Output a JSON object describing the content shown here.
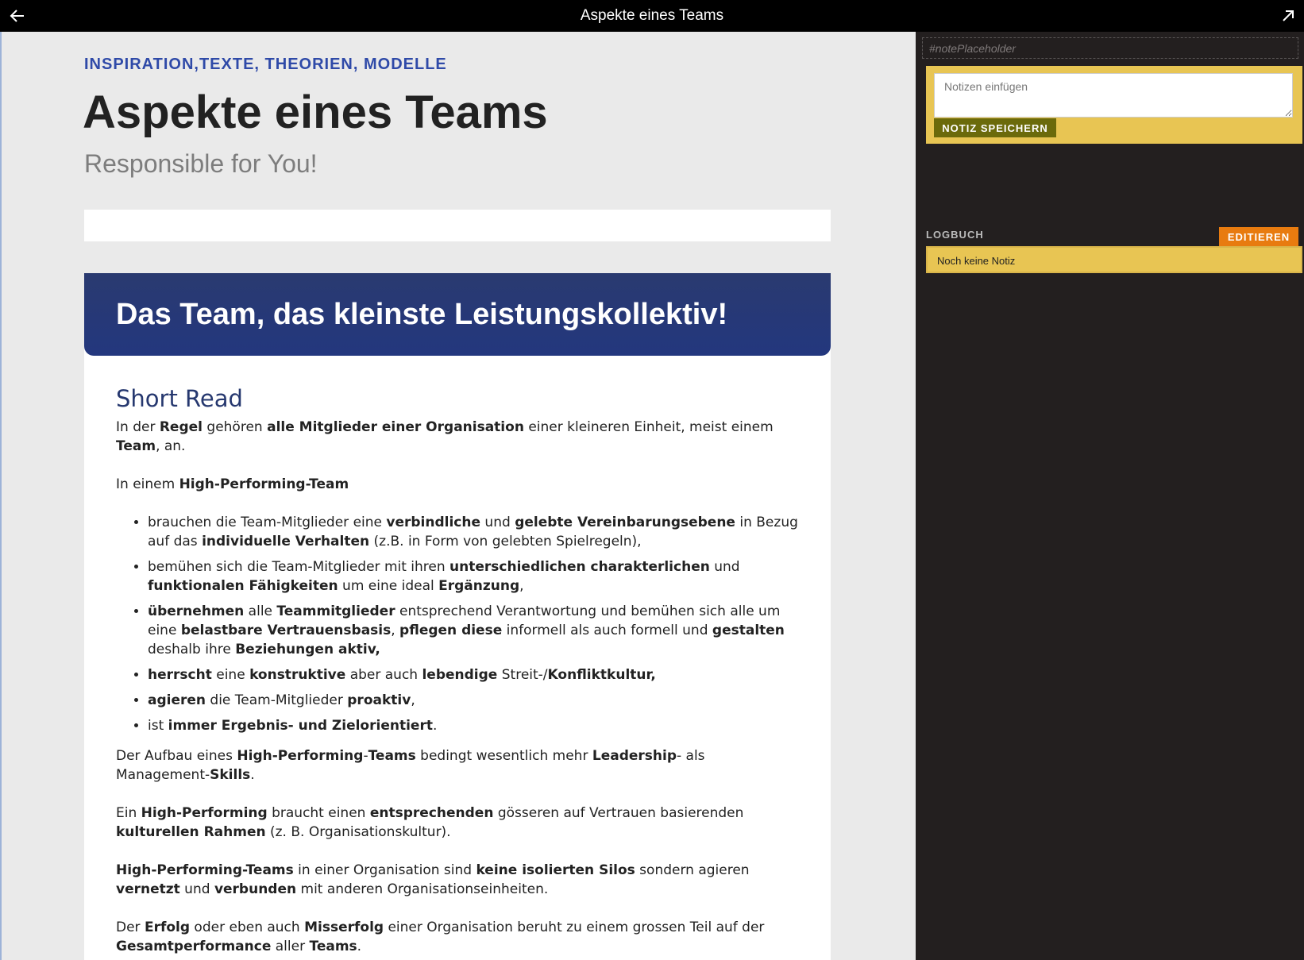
{
  "topbar": {
    "title": "Aspekte eines Teams",
    "back_icon": "arrow-left-icon",
    "expand_icon": "arrow-up-right-icon"
  },
  "main": {
    "kicker": "INSPIRATION,TEXTE, THEORIEN, MODELLE",
    "title": "Aspekte eines Teams",
    "subtitle": "Responsible for You!",
    "card": {
      "header": "Das Team, das kleinste Leistungskollektiv!",
      "section_title": "Short Read",
      "p1": [
        "In der ",
        "Regel",
        " gehören ",
        "alle Mitglieder einer Organisation",
        " einer kleineren Einheit, meist einem ",
        "Team",
        ", an."
      ],
      "p2": [
        "In einem ",
        "High-Performing-Team"
      ],
      "bullets": [
        [
          "brauchen die Team-Mitglieder eine ",
          "verbindliche",
          " und ",
          "gelebte Vereinbarungsebene",
          " in Bezug auf das ",
          "individuelle Verhalten",
          " (z.B. in Form von gelebten Spielregeln),"
        ],
        [
          "bemühen sich die Team-Mitglieder mit ihren ",
          "unterschiedlichen charakterlichen",
          " und ",
          "funktionalen Fähigkeiten",
          " um eine ideal ",
          "Ergänzung",
          ","
        ],
        [
          "",
          "übernehmen",
          " alle ",
          "Teammitglieder",
          " entsprechend Verantwortung und bemühen sich alle um eine ",
          "belastbare Vertrauensbasis",
          ", ",
          "pflegen diese",
          " informell als auch formell und ",
          "gestalten",
          " deshalb ihre ",
          "Beziehungen aktiv,"
        ],
        [
          "",
          "herrscht",
          " eine ",
          "konstruktive",
          " aber auch ",
          "lebendige",
          " Streit-/",
          "Konfliktkultur,"
        ],
        [
          "",
          "agieren",
          " die Team-Mitglieder ",
          "proaktiv",
          ","
        ],
        [
          "ist ",
          "immer Ergebnis- und Zielorientiert",
          "."
        ]
      ],
      "p3": [
        "Der Aufbau eines ",
        "High-Performing",
        "-",
        "Teams",
        " bedingt wesentlich mehr ",
        "Leadership",
        "- als Management-",
        "Skills",
        "."
      ],
      "p4": [
        "Ein ",
        "High-Performing",
        " braucht einen ",
        "entsprechenden",
        " gösseren auf Vertrauen basierenden ",
        "kulturellen Rahmen",
        " (z. B. Organisationskultur)."
      ],
      "p5": [
        "",
        "High-Performing-Teams",
        " in einer Organisation sind ",
        "keine isolierten Silos",
        " sondern agieren ",
        "vernetzt",
        " und ",
        "verbunden",
        " mit anderen Organisationseinheiten."
      ],
      "p6": [
        "Der ",
        "Erfolg",
        " oder eben auch ",
        "Misserfolg",
        " einer Organisation beruht zu einem grossen Teil auf der ",
        "Gesamtperformance",
        " aller ",
        "Teams",
        "."
      ]
    }
  },
  "sidebar": {
    "placeholder_label": "#notePlaceholder",
    "notes_placeholder": "Notizen einfügen",
    "save_label": "NOTIZ SPEICHERN",
    "log_label": "LOGBUCH",
    "edit_label": "EDITIEREN",
    "log_entry": "Noch keine Notiz"
  },
  "colors": {
    "topbar": "#000000",
    "kicker": "#2f4aa8",
    "card_header": "#23377e",
    "sidebar": "#231f1f",
    "note_yellow": "#e8c553",
    "save_button": "#6b6a0b",
    "edit_button": "#e87b0f"
  }
}
